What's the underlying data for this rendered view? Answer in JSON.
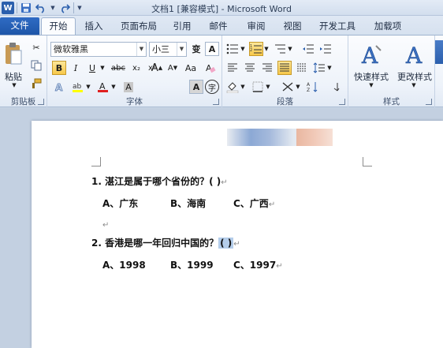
{
  "window": {
    "title": "文档1 [兼容模式] - Microsoft Word",
    "app_logo": "W"
  },
  "tabs": [
    {
      "label": "文件",
      "kind": "file"
    },
    {
      "label": "开始",
      "active": true
    },
    {
      "label": "插入"
    },
    {
      "label": "页面布局"
    },
    {
      "label": "引用"
    },
    {
      "label": "邮件"
    },
    {
      "label": "审阅"
    },
    {
      "label": "视图"
    },
    {
      "label": "开发工具"
    },
    {
      "label": "加载项"
    }
  ],
  "ribbon": {
    "clipboard": {
      "label": "剪贴板",
      "paste_label": "粘贴"
    },
    "font": {
      "label": "字体",
      "font_name": "微软雅黑",
      "font_size": "小三",
      "phonetic": "变",
      "border_char": "A",
      "bold": "B",
      "italic": "I",
      "underline": "U",
      "strike": "abc",
      "sub": "x₂",
      "sup": "x²",
      "grow": "A",
      "shrink": "A",
      "case": "Aa",
      "shading": "A",
      "enclose": "字"
    },
    "paragraph": {
      "label": "段落"
    },
    "styles": {
      "label": "样式",
      "quick_styles": "快速样式",
      "change_styles": "更改样式"
    }
  },
  "document": {
    "q1": {
      "number": "1.",
      "text": "湛江是属于哪个省份的？( )"
    },
    "q1_options": [
      "A、广东",
      "B、海南",
      "C、广西"
    ],
    "q2": {
      "number": "2.",
      "text_before": "香港是哪一年回归中国的？",
      "selected": "( )"
    },
    "q2_options": [
      "A、1998",
      "B、1999",
      "C、1997"
    ],
    "para_mark": "↵"
  },
  "colors": {
    "accent": "#2b5fad",
    "selection": "#b4cdea",
    "highlight_active": "#f7c84a"
  }
}
